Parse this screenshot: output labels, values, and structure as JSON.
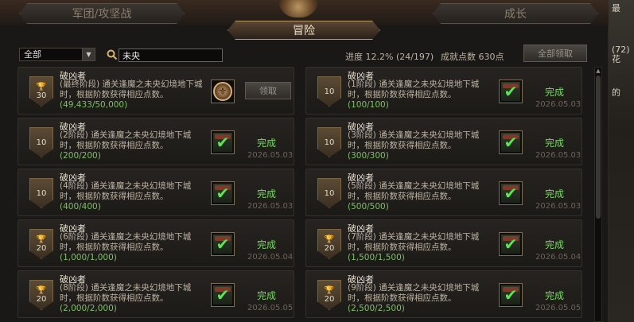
{
  "tabs": {
    "left": "军团/攻坚战",
    "center": "冒险",
    "right": "成长"
  },
  "filter": {
    "selected": "全部"
  },
  "search": {
    "value": "未央"
  },
  "progress": {
    "label": "进度",
    "value": "12.2% (24/197)"
  },
  "score": {
    "label": "成就点数",
    "value": "630点"
  },
  "claim_all_label": "全部领取",
  "right_strip": {
    "frag1": "最",
    "frag2": "(72)",
    "frag3": "花",
    "frag4": "的"
  },
  "cards": [
    {
      "title": "破凶者",
      "desc": "(最终阶段) 通关逢魔之未央幻境地下城时，根据阶数获得相应点数。",
      "count": "(49,433/50,000)",
      "points": "30",
      "trophy": true,
      "state": "claim",
      "status": "领取",
      "date": ""
    },
    {
      "title": "破凶者",
      "desc": "(1阶段) 通关逢魔之未央幻境地下城时，根据阶数获得相应点数。",
      "count": "(100/100)",
      "points": "10",
      "trophy": false,
      "state": "done",
      "status": "完成",
      "date": "2026.05.03"
    },
    {
      "title": "破凶者",
      "desc": "(2阶段) 通关逢魔之未央幻境地下城时，根据阶数获得相应点数。",
      "count": "(200/200)",
      "points": "10",
      "trophy": false,
      "state": "done",
      "status": "完成",
      "date": "2026.05.03"
    },
    {
      "title": "破凶者",
      "desc": "(3阶段) 通关逢魔之未央幻境地下城时，根据阶数获得相应点数。",
      "count": "(300/300)",
      "points": "10",
      "trophy": false,
      "state": "done",
      "status": "完成",
      "date": "2026.05.03"
    },
    {
      "title": "破凶者",
      "desc": "(4阶段) 通关逢魔之未央幻境地下城时，根据阶数获得相应点数。",
      "count": "(400/400)",
      "points": "10",
      "trophy": false,
      "state": "done",
      "status": "完成",
      "date": "2026.05.03"
    },
    {
      "title": "破凶者",
      "desc": "(5阶段) 通关逢魔之未央幻境地下城时，根据阶数获得相应点数。",
      "count": "(500/500)",
      "points": "10",
      "trophy": false,
      "state": "done",
      "status": "完成",
      "date": "2026.05.03"
    },
    {
      "title": "破凶者",
      "desc": "(6阶段) 通关逢魔之未央幻境地下城时，根据阶数获得相应点数。",
      "count": "(1,000/1,000)",
      "points": "20",
      "trophy": true,
      "state": "done",
      "status": "完成",
      "date": "2026.05.04"
    },
    {
      "title": "破凶者",
      "desc": "(7阶段) 通关逢魔之未央幻境地下城时，根据阶数获得相应点数。",
      "count": "(1,500/1,500)",
      "points": "20",
      "trophy": true,
      "state": "done",
      "status": "完成",
      "date": "2026.05.04"
    },
    {
      "title": "破凶者",
      "desc": "(8阶段) 通关逢魔之未央幻境地下城时，根据阶数获得相应点数。",
      "count": "(2,000/2,000)",
      "points": "20",
      "trophy": true,
      "state": "done",
      "status": "完成",
      "date": "2026.05.05"
    },
    {
      "title": "破凶者",
      "desc": "(9阶段) 通关逢魔之未央幻境地下城时，根据阶数获得相应点数。",
      "count": "(2,500/2,500)",
      "points": "20",
      "trophy": true,
      "state": "done",
      "status": "完成",
      "date": "2026.05.05"
    }
  ]
}
